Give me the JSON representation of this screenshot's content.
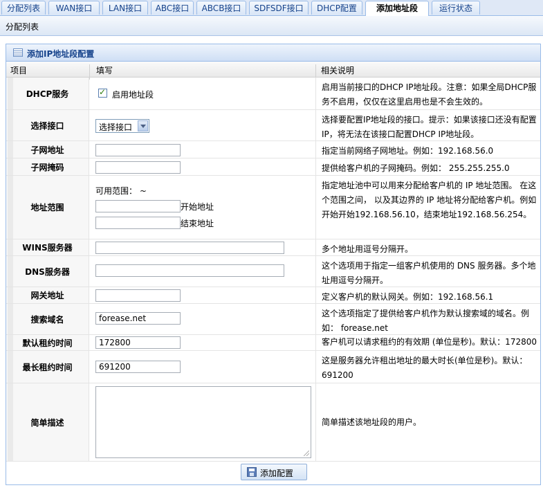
{
  "tabs": [
    {
      "label": "分配列表",
      "active": false
    },
    {
      "label": "WAN接口",
      "active": false
    },
    {
      "label": "LAN接口",
      "active": false
    },
    {
      "label": "ABC接口",
      "active": false
    },
    {
      "label": "ABCB接口",
      "active": false
    },
    {
      "label": "SDFSDF接口",
      "active": false
    },
    {
      "label": "DHCP配置",
      "active": false
    },
    {
      "label": "添加地址段",
      "active": true
    },
    {
      "label": "运行状态",
      "active": false
    }
  ],
  "breadcrumb": "分配列表",
  "panel": {
    "title": "添加IP地址段配置",
    "columns": {
      "item": "项目",
      "fill": "填写",
      "desc": "相关说明"
    }
  },
  "rows": {
    "dhcp": {
      "label": "DHCP服务",
      "checkbox_label": "启用地址段",
      "checked": true,
      "desc": "启用当前接口的DHCP IP地址段。注意：如果全局DHCP服务不启用，仅仅在这里启用也是不会生效的。"
    },
    "iface": {
      "label": "选择接口",
      "select_value": "选择接口",
      "desc": "选择要配置IP地址段的接口。提示：如果该接口还没有配置IP，将无法在该接口配置DHCP IP地址段。"
    },
    "subnet": {
      "label": "子网地址",
      "value": "",
      "desc": "指定当前网络子网地址。例如：192.168.56.0"
    },
    "mask": {
      "label": "子网掩码",
      "value": "",
      "desc": "提供给客户机的子网掩码。例如： 255.255.255.0"
    },
    "range": {
      "label": "地址范围",
      "available_label": "可用范围：  ~",
      "start_value": "",
      "start_label": "开始地址",
      "end_value": "",
      "end_label": "结束地址",
      "desc": "指定地址池中可以用来分配给客户机的 IP 地址范围。 在这个范围之间， 以及其边界的 IP 地址将分配给客户机。例如开始开始192.168.56.10，结束地址192.168.56.254。"
    },
    "wins": {
      "label": "WINS服务器",
      "value": "",
      "desc": "多个地址用逗号分隔开。"
    },
    "dns": {
      "label": "DNS服务器",
      "value": "",
      "desc": "这个选项用于指定一组客户机使用的 DNS 服务器。多个地址用逗号分隔开。"
    },
    "gateway": {
      "label": "网关地址",
      "value": "",
      "desc": "定义客户机的默认网关。例如：192.168.56.1"
    },
    "domain": {
      "label": "搜索域名",
      "value": "forease.net",
      "desc": "这个选项指定了提供给客户机作为默认搜索域的域名。例如： forease.net"
    },
    "default_lease": {
      "label": "默认租约时间",
      "value": "172800",
      "desc": "客户机可以请求租约的有效期 (单位是秒)。默认：172800"
    },
    "max_lease": {
      "label": "最长租约时间",
      "value": "691200",
      "desc": "这是服务器允许租出地址的最大时长(单位是秒)。默认：691200"
    },
    "note": {
      "label": "简单描述",
      "value": "",
      "desc": "简单描述该地址段的用户。"
    }
  },
  "submit_label": "添加配置"
}
